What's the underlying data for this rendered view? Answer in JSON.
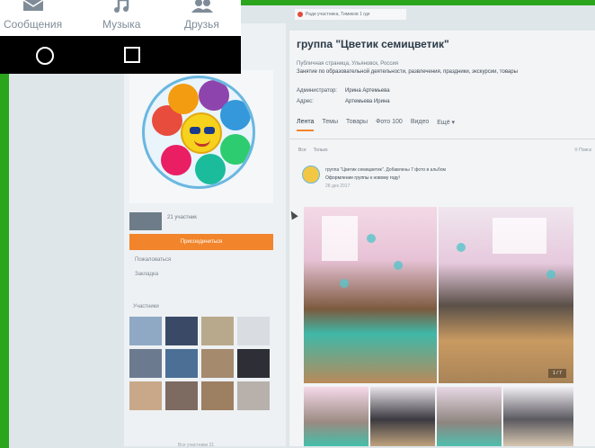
{
  "phone": {
    "nav": [
      {
        "label": "Сообщения",
        "icon": "envelope-icon"
      },
      {
        "label": "Музыка",
        "icon": "music-note-icon"
      },
      {
        "label": "Друзья",
        "icon": "friends-icon"
      }
    ],
    "system_buttons": [
      "home-circle-icon",
      "recents-square-icon"
    ],
    "colors": {
      "bar": "#000000",
      "label": "#7f8c98"
    }
  },
  "notification": {
    "text": "Ради участника, Тимиков 1 где"
  },
  "group": {
    "title": "группа \"Цветик семицветик\"",
    "subtitle": "Публичная страница, Ульяновск, Россия",
    "description": "Занятие по образовательной деятельности, развлечения, праздники, экскурсии, товары",
    "info": [
      {
        "key": "Администратор:",
        "value": "Ирина Артемьева"
      },
      {
        "key": "Адрес:",
        "value": "Артемьева Ирина"
      }
    ],
    "tabs": [
      "Лента",
      "Темы",
      "Товары",
      "Фото 100",
      "Видео",
      "Ещё ▾"
    ],
    "active_tab": "Лента",
    "subtabs": [
      "Все",
      "Только"
    ],
    "search_hint": "Поиск"
  },
  "sidebar": {
    "members_count": "21 участник",
    "join_label": "Присоединиться",
    "links": [
      "Пожаловаться",
      "Закладка"
    ],
    "members_title": "Участники",
    "all_members": "Все участники 21",
    "accent": "#f2842b"
  },
  "post": {
    "author": "группа \"Цветик семицветик\". Добавлены 7 фото в альбом",
    "text": "Оформление группы к новому году!",
    "date": "28 дек 2017"
  },
  "photos": {
    "counter": "1 / 7"
  }
}
